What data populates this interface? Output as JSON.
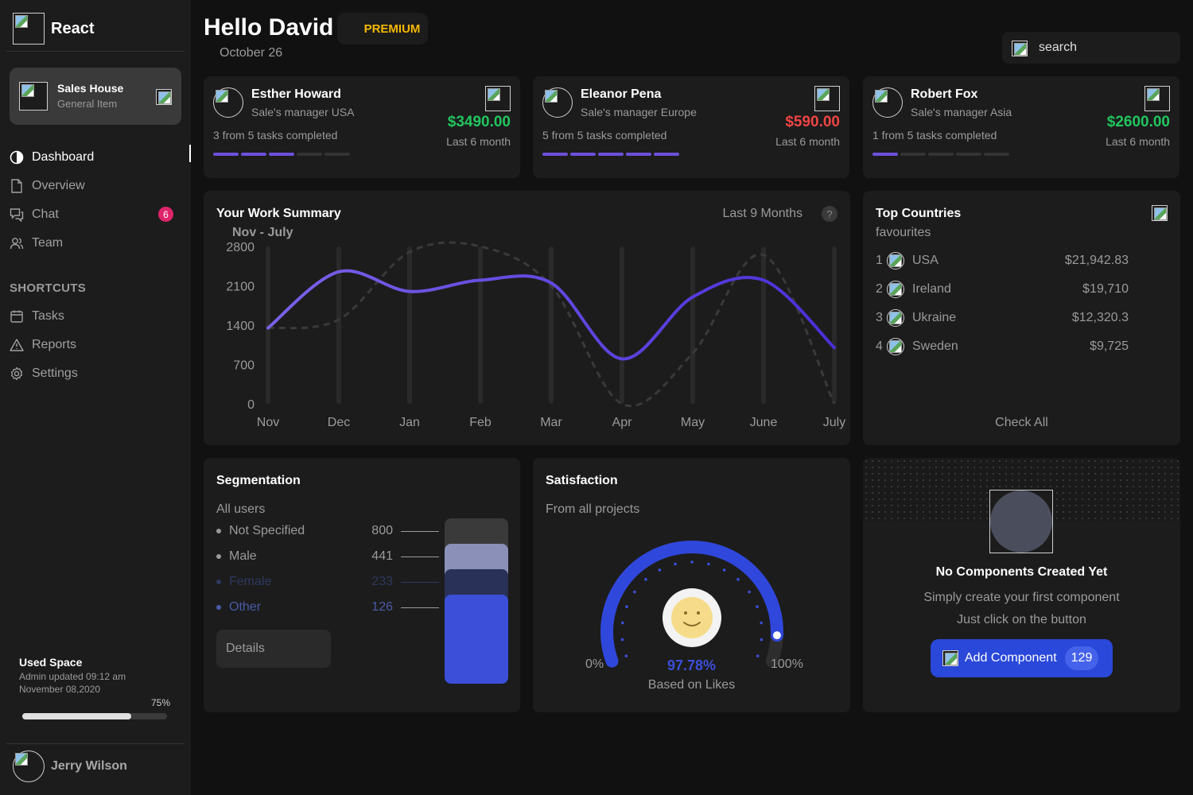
{
  "app": {
    "name": "React"
  },
  "workspace": {
    "title": "Sales House",
    "subtitle": "General Item"
  },
  "nav": {
    "items": [
      {
        "label": "Dashboard",
        "icon": "dashboard-icon",
        "active": true
      },
      {
        "label": "Overview",
        "icon": "document-icon"
      },
      {
        "label": "Chat",
        "icon": "chat-icon",
        "badge": "6"
      },
      {
        "label": "Team",
        "icon": "team-icon"
      }
    ],
    "shortcuts_title": "SHORTCUTS",
    "shortcuts": [
      {
        "label": "Tasks",
        "icon": "calendar-icon"
      },
      {
        "label": "Reports",
        "icon": "warning-icon"
      },
      {
        "label": "Settings",
        "icon": "gear-icon"
      }
    ]
  },
  "used_space": {
    "title": "Used Space",
    "line1": "Admin updated 09:12 am",
    "line2": "November 08,2020",
    "percent_label": "75%",
    "percent": 75
  },
  "user": {
    "name": "Jerry Wilson"
  },
  "header": {
    "greeting": "Hello David",
    "badge": "PREMIUM",
    "date": "October 26"
  },
  "search": {
    "placeholder": "search",
    "value": ""
  },
  "managers": [
    {
      "name": "Esther Howard",
      "role": "Sale's manager USA",
      "tasks": "3 from 5 tasks completed",
      "done": 3,
      "total": 5,
      "amount": "$3490.00",
      "amount_color": "#22c55e",
      "period": "Last 6 month"
    },
    {
      "name": "Eleanor Pena",
      "role": "Sale's manager Europe",
      "tasks": "5 from 5 tasks completed",
      "done": 5,
      "total": 5,
      "amount": "$590.00",
      "amount_color": "#ef4444",
      "period": "Last 6 month"
    },
    {
      "name": "Robert Fox",
      "role": "Sale's manager Asia",
      "tasks": "1 from 5 tasks completed",
      "done": 1,
      "total": 5,
      "amount": "$2600.00",
      "amount_color": "#22c55e",
      "period": "Last 6 month"
    }
  ],
  "work_summary": {
    "title": "Your Work Summary",
    "subtitle": "Nov - July",
    "range": "Last 9 Months",
    "help": "?"
  },
  "chart_data": {
    "type": "line",
    "categories": [
      "Nov",
      "Dec",
      "Jan",
      "Feb",
      "Mar",
      "Apr",
      "May",
      "June",
      "July"
    ],
    "yticks": [
      0,
      700,
      1400,
      2100,
      2800
    ],
    "ylim": [
      0,
      2800
    ],
    "grid": false,
    "series": [
      {
        "values": [
          1350,
          2350,
          2000,
          2200,
          2150,
          800,
          1900,
          2200,
          1000
        ],
        "style": "solid",
        "color_start": "#7b61e8",
        "color_end": "#4b2fd8"
      },
      {
        "values": [
          1350,
          1500,
          2700,
          2800,
          2100,
          0,
          900,
          2650,
          0
        ],
        "style": "dashed",
        "color": "#3a3a3a"
      }
    ]
  },
  "countries": {
    "title": "Top Countries",
    "subtitle": "favourites",
    "items": [
      {
        "rank": "1",
        "name": "USA",
        "value": "$21,942.83"
      },
      {
        "rank": "2",
        "name": "Ireland",
        "value": "$19,710"
      },
      {
        "rank": "3",
        "name": "Ukraine",
        "value": "$12,320.3"
      },
      {
        "rank": "4",
        "name": "Sweden",
        "value": "$9,725"
      }
    ],
    "check_all": "Check All"
  },
  "segmentation": {
    "title": "Segmentation",
    "subtitle": "All users",
    "items": [
      {
        "label": "Not Specified",
        "value": "800",
        "color": "#3a3a3a",
        "text_color": "#9a9a9a"
      },
      {
        "label": "Male",
        "value": "441",
        "color": "#8a90b8",
        "text_color": "#9a9a9a"
      },
      {
        "label": "Female",
        "value": "233",
        "color": "#2a3158",
        "text_color": "#2f3860"
      },
      {
        "label": "Other",
        "value": "126",
        "color": "#3b4fd8",
        "text_color": "#4a5aa8"
      }
    ],
    "details": "Details"
  },
  "satisfaction": {
    "title": "Satisfaction",
    "subtitle": "From all projects",
    "min": "0%",
    "max": "100%",
    "value_label": "97.78%",
    "value": 97.78,
    "note": "Based on Likes"
  },
  "components": {
    "title": "No Components Created Yet",
    "line1": "Simply create your first component",
    "line2": "Just click on the button",
    "button": "Add Component",
    "count": "129"
  }
}
